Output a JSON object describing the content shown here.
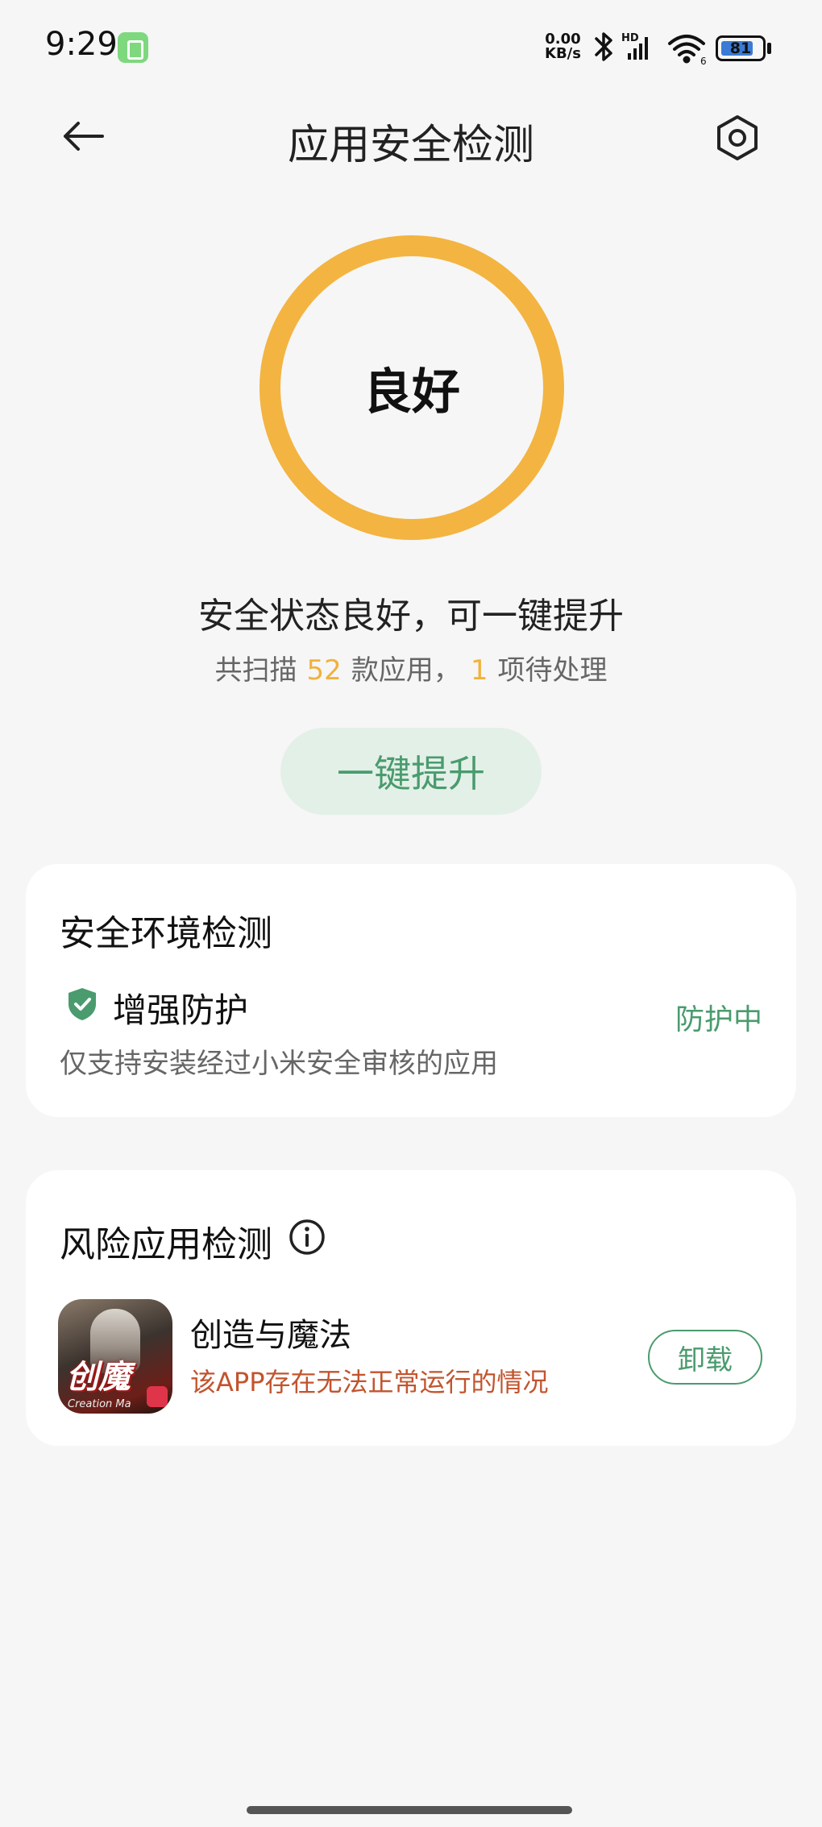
{
  "status_bar": {
    "time": "9:29",
    "speed_value": "0.00",
    "speed_unit": "KB/s",
    "battery": "81",
    "battery_level": 0.81,
    "icons": [
      "app-notification-icon",
      "bluetooth-icon",
      "hd-signal-icon",
      "wifi-icon",
      "battery-icon"
    ]
  },
  "header": {
    "title": "应用安全检测",
    "back_icon": "back-arrow-icon",
    "settings_icon": "settings-gear-icon"
  },
  "score": {
    "label": "良好",
    "ring_color": "#f3b441"
  },
  "summary": {
    "title": "安全状态良好，可一键提升",
    "prefix": "共扫描",
    "app_count": "52",
    "middle": "款应用，",
    "pending_count": "1",
    "suffix": "项待处理"
  },
  "upgrade_button": {
    "label": "一键提升"
  },
  "env_card": {
    "title": "安全环境检测",
    "item_title": "增强防护",
    "item_desc": "仅支持安装经过小米安全审核的应用",
    "item_status": "防护中",
    "item_icon": "shield-check-icon"
  },
  "risk_card": {
    "title": "风险应用检测",
    "info_icon": "info-icon",
    "apps": [
      {
        "name": "创造与魔法",
        "icon_text": "创魔",
        "icon_subtext": "Creation Ma",
        "warning": "该APP存在无法正常运行的情况",
        "action": "卸载"
      }
    ]
  },
  "colors": {
    "accent_green": "#4a9b6e",
    "accent_orange": "#f3b441",
    "warning_red": "#c2542e",
    "background": "#f6f6f6"
  }
}
